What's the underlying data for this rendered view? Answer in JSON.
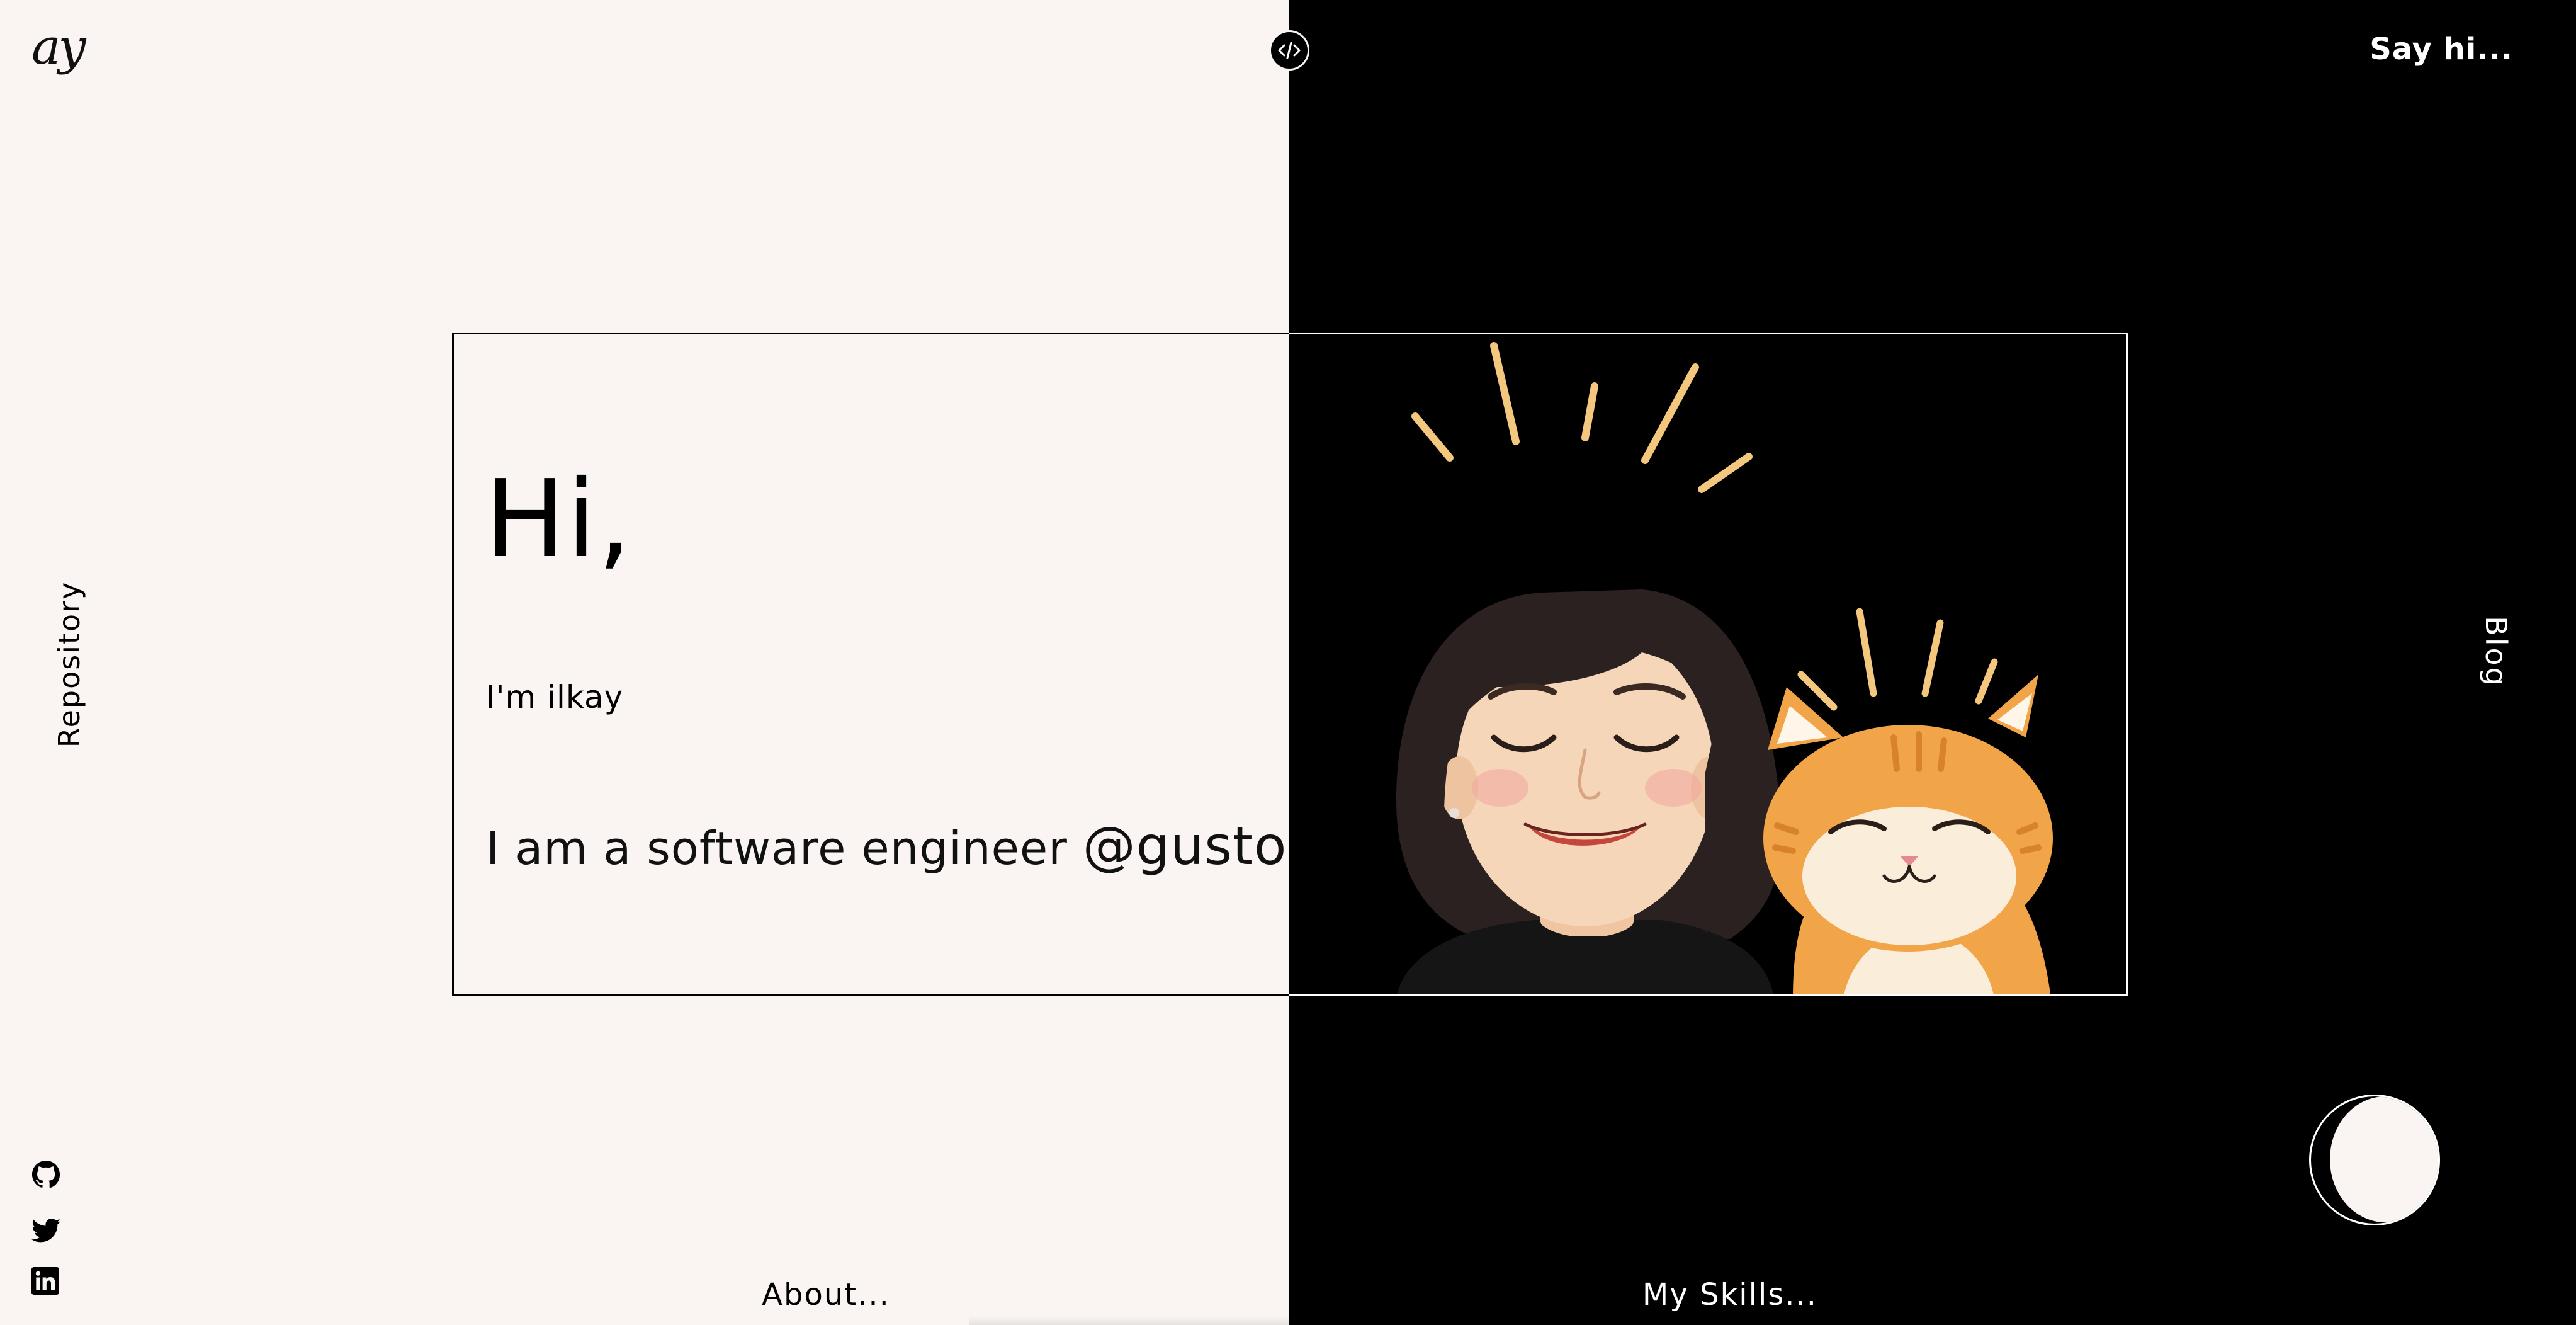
{
  "header": {
    "logo_text": "ay",
    "say_hi_label": "Say hi..."
  },
  "nav": {
    "repository_label": "Repository",
    "blog_label": "Blog",
    "about_label": "About...",
    "skills_label": "My Skills..."
  },
  "hero": {
    "greeting": "Hi,",
    "intro": "I'm ilkay",
    "tagline_prefix": "I am a software engineer ",
    "tagline_company": "@gusto"
  },
  "social": [
    {
      "icon": "github-icon"
    },
    {
      "icon": "twitter-icon"
    },
    {
      "icon": "linkedin-icon"
    }
  ],
  "theme_toggle": {
    "icon": "moon-icon"
  },
  "colors": {
    "light_bg": "#faf5f2",
    "dark_bg": "#000000",
    "cat_orange": "#f2a548",
    "hair": "#2b2120"
  }
}
